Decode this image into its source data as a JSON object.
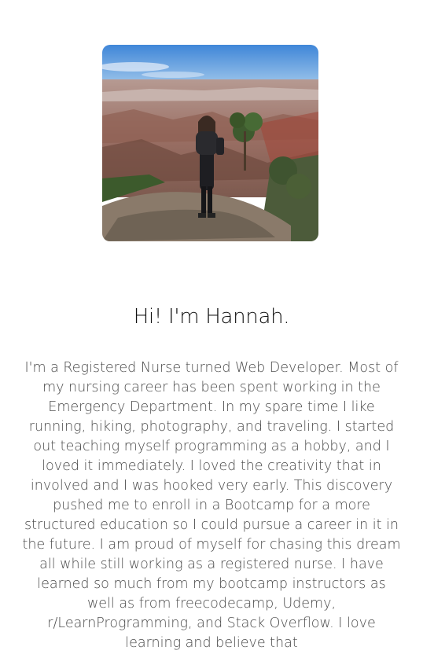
{
  "profile": {
    "photo_alt": "Hannah at the Grand Canyon",
    "greeting": "Hi! I'm Hannah.",
    "bio": "I'm a Registered Nurse turned Web Developer. Most of my nursing career has been spent working in the Emergency Department. In my spare time I like running, hiking, photography, and traveling. I started out teaching myself programming as a hobby, and I loved it immediately. I loved the creativity that in involved and I was hooked very early. This discovery pushed me to enroll in a Bootcamp for a more structured education so I could pursue a career in it in the future. I am proud of myself for chasing this dream all while still working as a registered nurse. I have learned so much from my bootcamp instructors as well as from freecodecamp, Udemy, r/LearnProgramming, and Stack Overflow. I love learning and believe that"
  },
  "colors": {
    "heading": "#111111",
    "body_text": "#4a4a4a",
    "background": "#ffffff"
  }
}
